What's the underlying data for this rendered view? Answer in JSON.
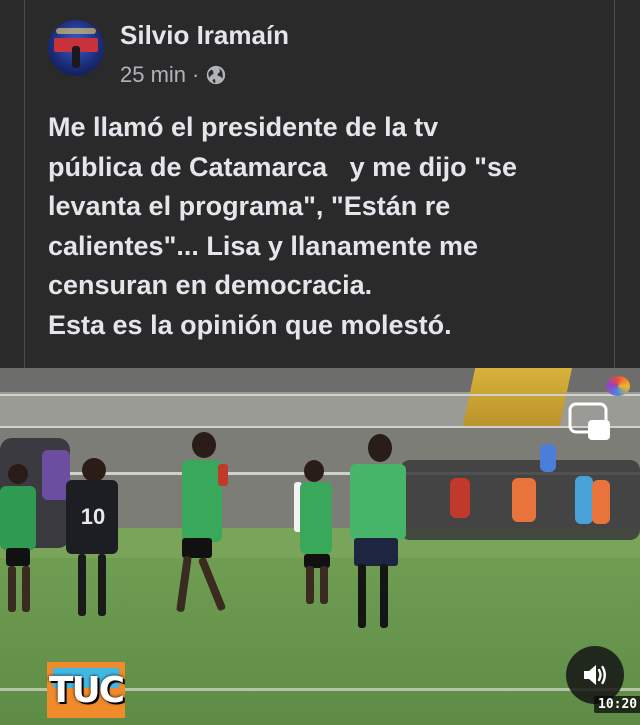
{
  "post": {
    "author": "Silvio Iramaín",
    "time": "25 min",
    "separator": "·",
    "audience_icon": "globe-icon",
    "text_lines": [
      "Me llamó el presidente de la tv",
      "pública de Catamarca   y me dijo \"se",
      "levanta el programa\", \"Están re",
      "calientes\"... Lisa y llanamente me",
      "censuran en democracia.",
      "Esta es la opinión que molestó."
    ]
  },
  "video": {
    "channel_logo": "TUC",
    "jersey_number": "10",
    "timer": "10:20",
    "controls": {
      "pip_icon": "picture-in-picture-icon",
      "sound_icon": "speaker-icon"
    }
  }
}
